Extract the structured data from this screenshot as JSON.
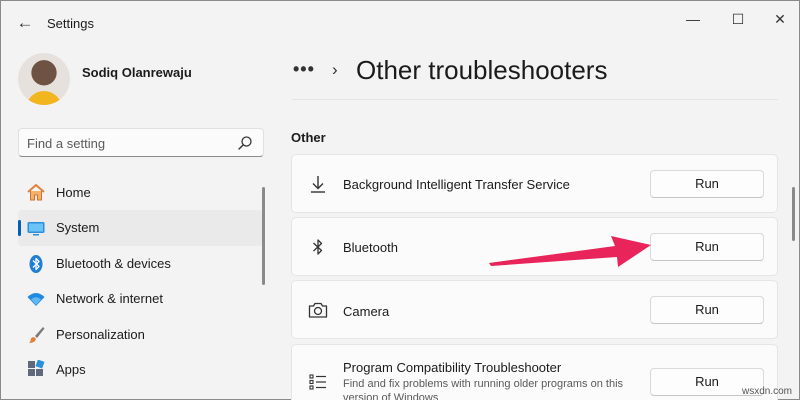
{
  "window": {
    "title": "Settings",
    "controls": {
      "minimize": "—",
      "maximize": "☐",
      "close": "✕"
    }
  },
  "user": {
    "name": "Sodiq Olanrewaju"
  },
  "search": {
    "placeholder": "Find a setting"
  },
  "sidebar": {
    "items": [
      {
        "label": "Home",
        "icon": "home-icon",
        "active": false
      },
      {
        "label": "System",
        "icon": "system-icon",
        "active": true
      },
      {
        "label": "Bluetooth & devices",
        "icon": "bluetooth-icon",
        "active": false
      },
      {
        "label": "Network & internet",
        "icon": "wifi-icon",
        "active": false
      },
      {
        "label": "Personalization",
        "icon": "paintbrush-icon",
        "active": false
      },
      {
        "label": "Apps",
        "icon": "apps-icon",
        "active": false
      }
    ]
  },
  "header": {
    "breadcrumb_overflow": "•••",
    "breadcrumb_separator": "›",
    "title": "Other troubleshooters"
  },
  "section": {
    "title": "Other",
    "troubleshooters": [
      {
        "title": "Background Intelligent Transfer Service",
        "description": "",
        "button": "Run",
        "icon": "download-icon"
      },
      {
        "title": "Bluetooth",
        "description": "",
        "button": "Run",
        "icon": "bluetooth-icon"
      },
      {
        "title": "Camera",
        "description": "",
        "button": "Run",
        "icon": "camera-icon"
      },
      {
        "title": "Program Compatibility Troubleshooter",
        "description": "Find and fix problems with running older programs on this version of Windows",
        "button": "Run",
        "icon": "program-list-icon"
      }
    ]
  },
  "annotation": {
    "arrow_color": "#e8245a"
  },
  "watermark": "wsxdn.com",
  "colors": {
    "accent": "#005fb8",
    "background": "#f3f3f3",
    "card": "#fbfbfb"
  }
}
